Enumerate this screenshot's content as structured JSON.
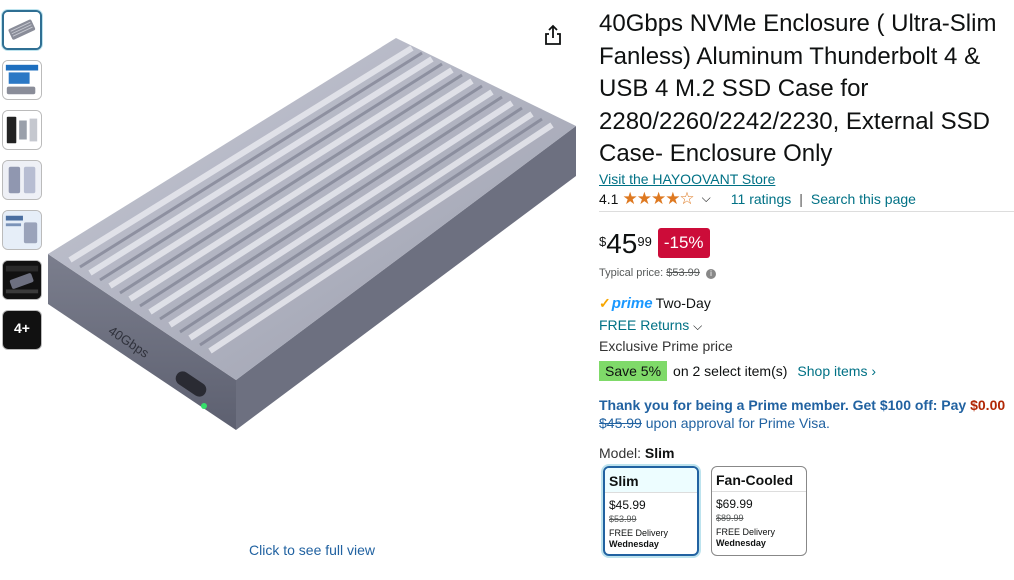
{
  "thumbnails": [
    {
      "icon": "enclosure-thumb-icon",
      "selected": true
    },
    {
      "icon": "enclosure-screen-thumb-icon"
    },
    {
      "icon": "enclosure-parts-thumb-icon"
    },
    {
      "icon": "enclosure-open-thumb-icon"
    },
    {
      "icon": "enclosure-info-thumb-icon"
    },
    {
      "icon": "enclosure-speed-thumb-icon"
    },
    {
      "icon": "more-images-icon",
      "label": "4+"
    }
  ],
  "image": {
    "see_full": "Click to see full view",
    "brand_text": "40Gbps"
  },
  "product": {
    "title": "40Gbps NVMe Enclosure ( Ultra-Slim Fanless) Aluminum Thunderbolt 4 & USB 4 M.2 SSD Case for 2280/2260/2242/2230, External SSD Case- Enclosure Only",
    "store_link": "Visit the HAYOOVANT Store",
    "rating": "4.1",
    "stars": "★★★★☆",
    "ratings_count": "11 ratings",
    "search_page": "Search this page"
  },
  "price": {
    "currency": "$",
    "whole": "45",
    "fraction": "99",
    "discount": "-15%",
    "typical_label": "Typical price:",
    "typical_value": "$53.99"
  },
  "prime": {
    "logo": "prime",
    "delivery": "Two-Day",
    "free_returns": "FREE Returns",
    "exclusive": "Exclusive Prime price"
  },
  "promo": {
    "save_badge": "Save 5%",
    "save_text": "on 2 select item(s)",
    "shop_items": "Shop items ›"
  },
  "card_offer": {
    "line1": "Thank you for being a Prime member. Get $100 off: Pay ",
    "pay_amount": "$0.00",
    "old_price": "$45.99",
    "line2": "upon approval for Prime Visa."
  },
  "model": {
    "label": "Model:",
    "selected": "Slim",
    "options": [
      {
        "name": "Slim",
        "price": "$45.99",
        "list_price": "$53.99",
        "delivery": "FREE Delivery",
        "day": "Wednesday"
      },
      {
        "name": "Fan-Cooled",
        "price": "$69.99",
        "list_price": "$89.99",
        "delivery": "FREE Delivery",
        "day": "Wednesday"
      }
    ]
  },
  "colors": {
    "link": "#007185",
    "discount_red": "#cc0c39",
    "star": "#de7921",
    "save_green": "#7fda69",
    "prime_blue": "#1a98ff"
  }
}
